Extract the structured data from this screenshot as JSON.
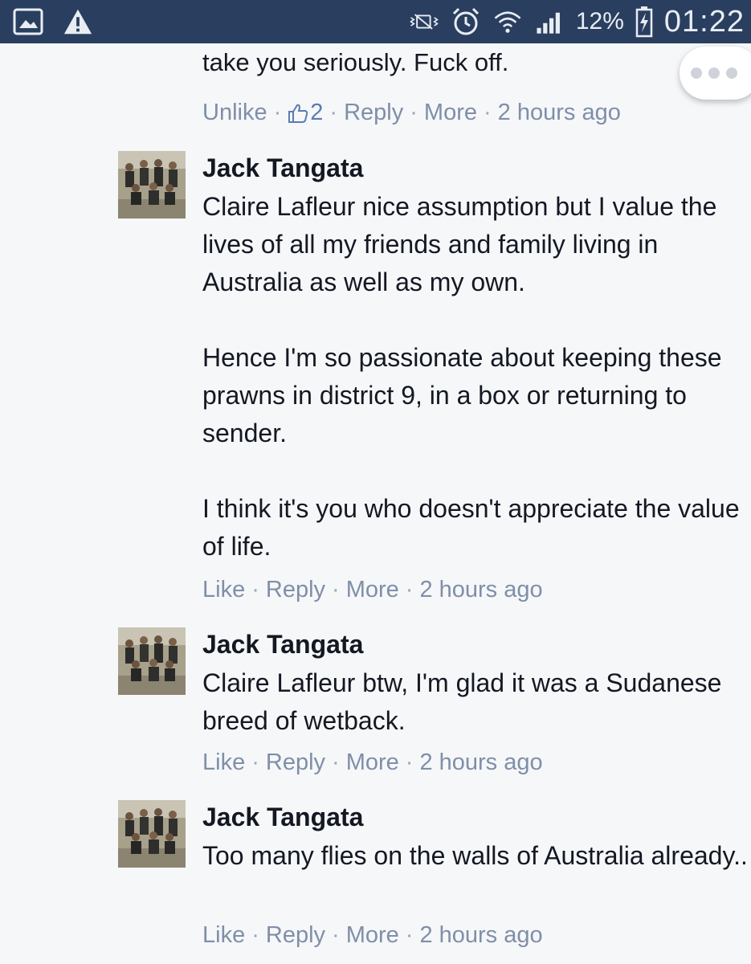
{
  "status_bar": {
    "battery": "12%",
    "time": "01:22",
    "icons": [
      "image-icon",
      "warning-icon",
      "nfc-vibrate-icon",
      "alarm-icon",
      "wifi-icon",
      "signal-icon",
      "battery-icon"
    ]
  },
  "partial_comment": {
    "last_line": "take you seriously. Fuck off.",
    "actions": {
      "unlike": "Unlike",
      "like_count": "2",
      "reply": "Reply",
      "more": "More",
      "time": "2 hours ago"
    }
  },
  "comments": [
    {
      "author": "Jack Tangata",
      "paragraphs": [
        "Claire Lafleur nice assumption but I value the lives of all my friends and family living in Australia as well as my own.",
        "Hence I'm so passionate about keeping these prawns in district 9, in a box or returning to sender.",
        "I think it's you who doesn't appreciate the value of life."
      ],
      "actions": {
        "like": "Like",
        "reply": "Reply",
        "more": "More",
        "time": "2 hours ago"
      }
    },
    {
      "author": "Jack Tangata",
      "paragraphs": [
        "Claire Lafleur btw, I'm glad it was a Sudanese breed of wetback."
      ],
      "actions": {
        "like": "Like",
        "reply": "Reply",
        "more": "More",
        "time": "2 hours ago"
      }
    },
    {
      "author": "Jack Tangata",
      "paragraphs": [
        "Too many flies on the walls of Australia already.."
      ],
      "actions": {
        "like": "Like",
        "reply": "Reply",
        "more": "More",
        "time": "2 hours ago"
      }
    }
  ],
  "colors": {
    "status_bar_bg": "#2a3f5f",
    "page_bg": "#f6f7f9",
    "action_text": "#8794a9",
    "like_blue": "#5b7bb5"
  }
}
